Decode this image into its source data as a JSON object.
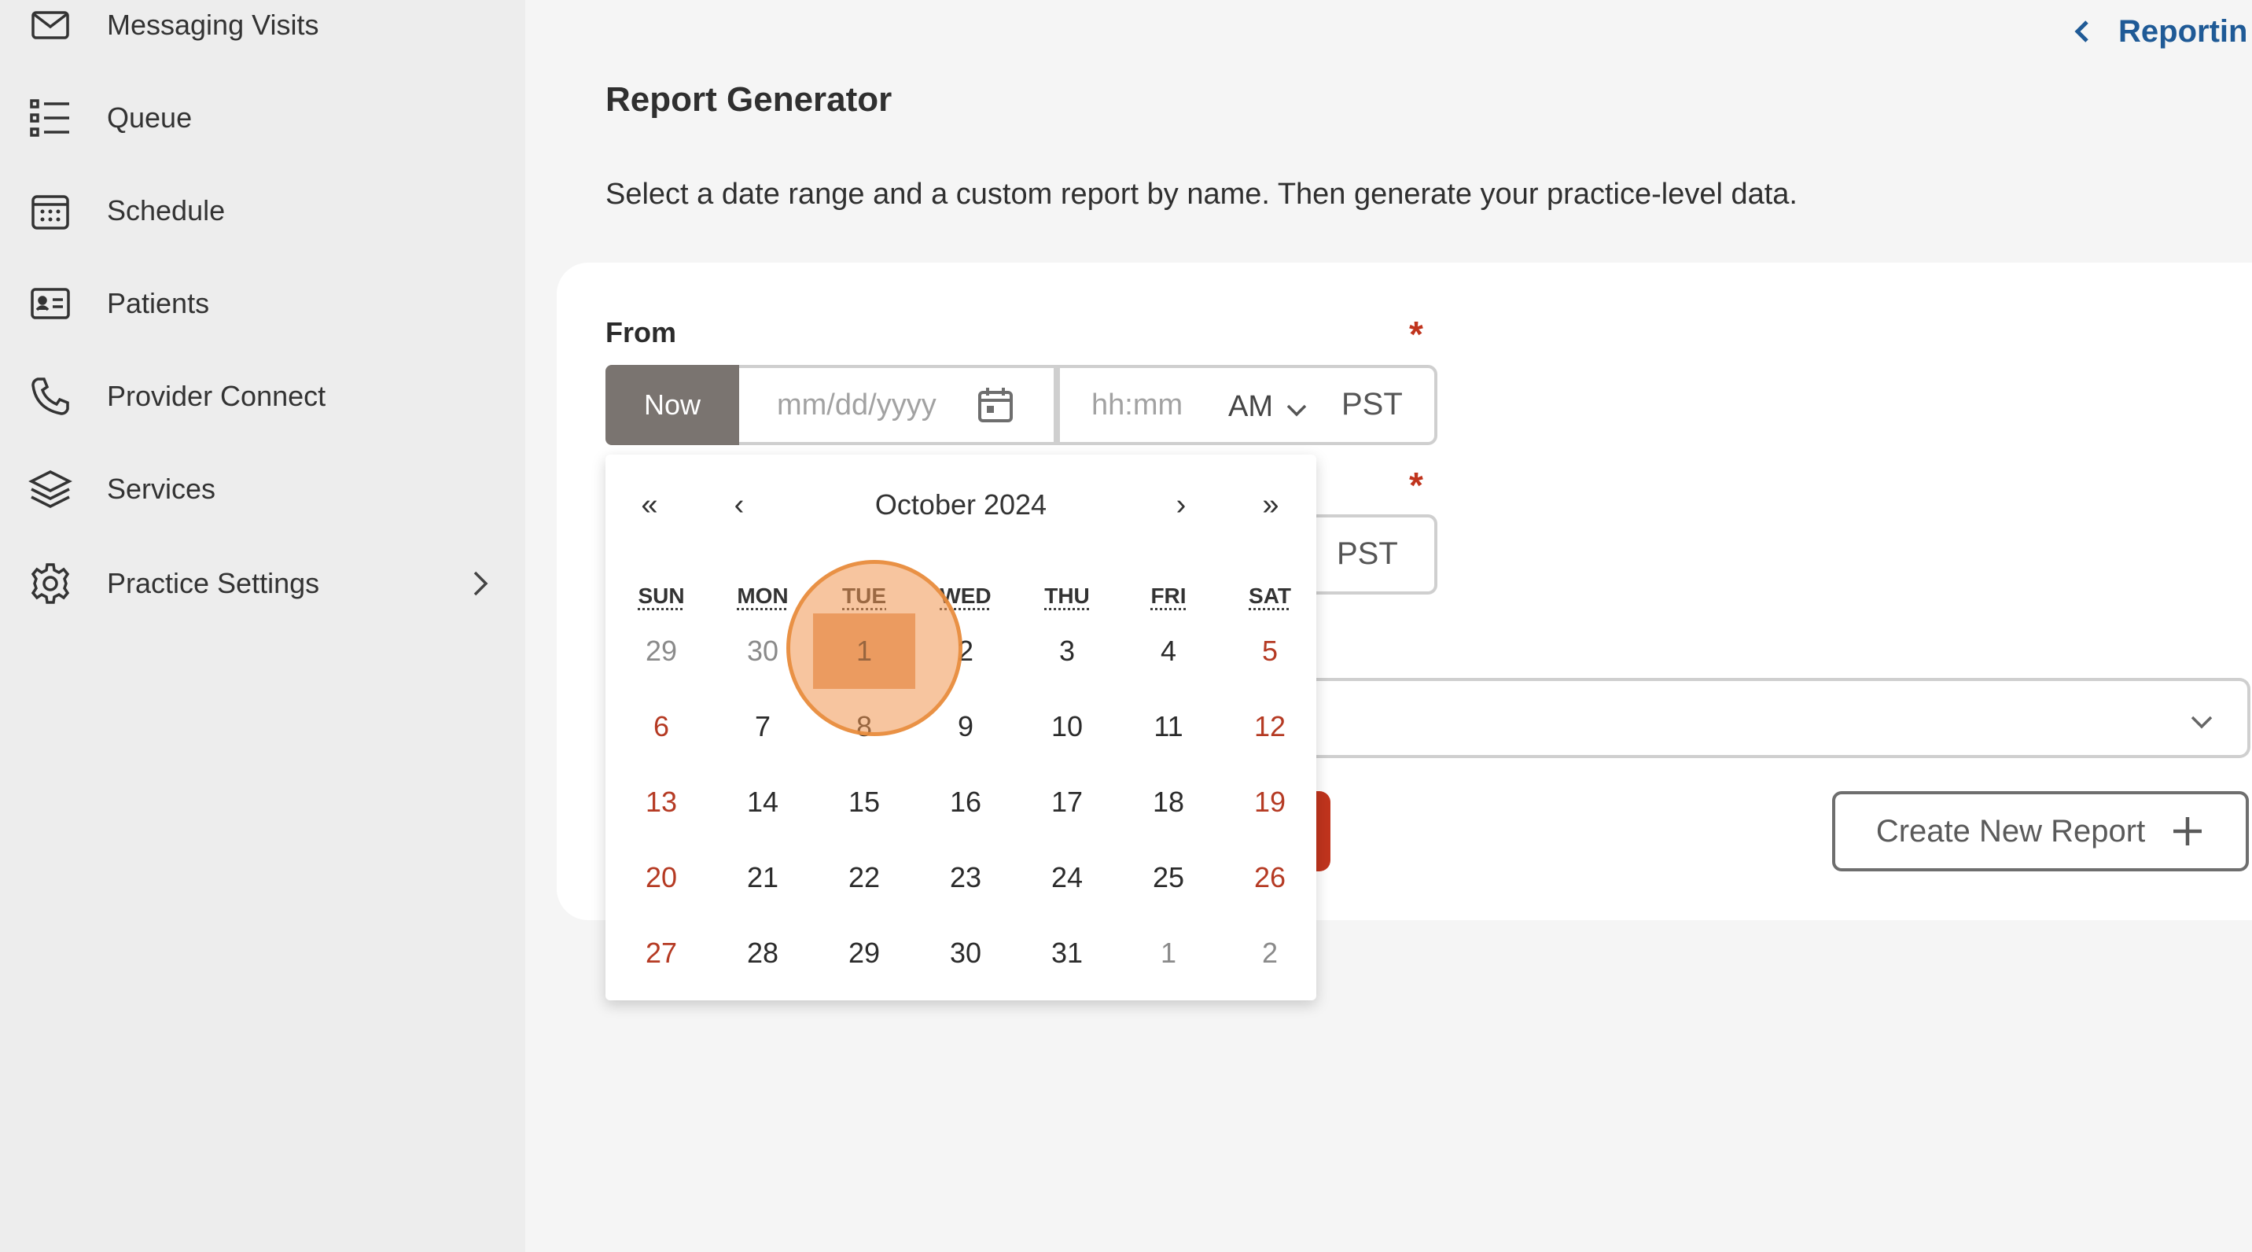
{
  "sidebar": {
    "items": [
      {
        "label": "Messaging Visits",
        "icon": "envelope-icon"
      },
      {
        "label": "Queue",
        "icon": "list-icon"
      },
      {
        "label": "Schedule",
        "icon": "calendar-grid-icon"
      },
      {
        "label": "Patients",
        "icon": "id-card-icon"
      },
      {
        "label": "Provider Connect",
        "icon": "phone-icon"
      },
      {
        "label": "Services",
        "icon": "layers-icon"
      },
      {
        "label": "Practice Settings",
        "icon": "gear-icon"
      }
    ]
  },
  "header": {
    "back_label": "Reportin"
  },
  "page": {
    "title": "Report Generator",
    "description": "Select a date range and a custom report by name. Then generate your practice-level data."
  },
  "form": {
    "from_label": "From",
    "required_mark": "*",
    "now_label": "Now",
    "date_placeholder": "mm/dd/yyyy",
    "time_placeholder": "hh:mm",
    "ampm": "AM",
    "timezone": "PST",
    "to_timezone": "PST",
    "create_report_label": "Create New Report"
  },
  "calendar": {
    "month_label": "October 2024",
    "prev_year": "«",
    "prev_month": "‹",
    "next_month": "›",
    "next_year": "»",
    "weekdays": [
      "SUN",
      "MON",
      "TUE",
      "WED",
      "THU",
      "FRI",
      "SAT"
    ],
    "weeks": [
      [
        "29",
        "30",
        "1",
        "2",
        "3",
        "4",
        "5"
      ],
      [
        "6",
        "7",
        "8",
        "9",
        "10",
        "11",
        "12"
      ],
      [
        "13",
        "14",
        "15",
        "16",
        "17",
        "18",
        "19"
      ],
      [
        "20",
        "21",
        "22",
        "23",
        "24",
        "25",
        "26"
      ],
      [
        "27",
        "28",
        "29",
        "30",
        "31",
        "1",
        "2"
      ]
    ],
    "selected_day": "1",
    "colors": {
      "weekend": "#b53a23",
      "selected": "#e5a373"
    }
  },
  "colors": {
    "accent": "#c0341d",
    "link": "#1f5a96",
    "now_button": "#7a7470"
  }
}
